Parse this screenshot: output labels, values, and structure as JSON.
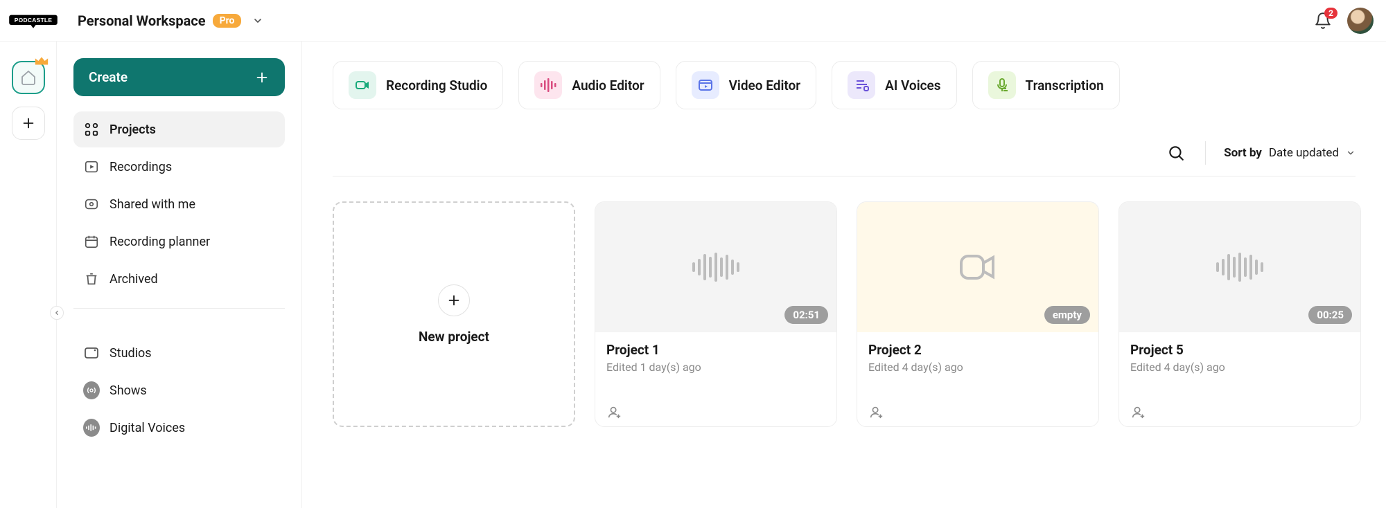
{
  "header": {
    "workspace_name": "Personal Workspace",
    "plan_badge": "Pro",
    "notifications_count": "2"
  },
  "sidebar": {
    "create_label": "Create",
    "primary": [
      {
        "label": "Projects"
      },
      {
        "label": "Recordings"
      },
      {
        "label": "Shared with me"
      },
      {
        "label": "Recording planner"
      },
      {
        "label": "Archived"
      }
    ],
    "secondary": [
      {
        "label": "Studios"
      },
      {
        "label": "Shows"
      },
      {
        "label": "Digital Voices"
      }
    ]
  },
  "tools": [
    {
      "label": "Recording Studio",
      "bg": "#e3f5ee",
      "fg": "#17a97a"
    },
    {
      "label": "Audio Editor",
      "bg": "#fde5ee",
      "fg": "#d94b7f"
    },
    {
      "label": "Video Editor",
      "bg": "#e7ecff",
      "fg": "#5a74e8"
    },
    {
      "label": "AI Voices",
      "bg": "#ece8fb",
      "fg": "#6a51d9"
    },
    {
      "label": "Transcription",
      "bg": "#eaf7dc",
      "fg": "#6aa92f"
    }
  ],
  "sort": {
    "label": "Sort by",
    "value": "Date updated"
  },
  "grid": {
    "new_label": "New project",
    "projects": [
      {
        "title": "Project 1",
        "subtitle": "Edited 1 day(s) ago",
        "badge": "02:51",
        "type": "audio"
      },
      {
        "title": "Project 2",
        "subtitle": "Edited 4 day(s) ago",
        "badge": "empty",
        "type": "video"
      },
      {
        "title": "Project 5",
        "subtitle": "Edited 4 day(s) ago",
        "badge": "00:25",
        "type": "audio"
      }
    ]
  }
}
